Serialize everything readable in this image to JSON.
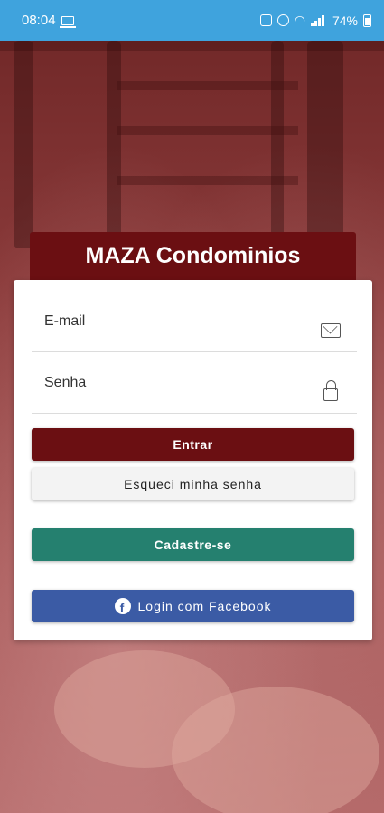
{
  "status_bar": {
    "time": "08:04",
    "battery": "74%",
    "icons": [
      "laptop-icon",
      "alarm-icon",
      "wifi-icon",
      "signal-icon",
      "battery-icon"
    ]
  },
  "app": {
    "title": "MAZA Condominios"
  },
  "login_form": {
    "email_placeholder": "E-mail",
    "email_icon": "mail-icon",
    "password_placeholder": "Senha",
    "password_icon": "lock-icon",
    "submit_label": "Entrar",
    "forgot_label": "Esqueci minha senha",
    "register_label": "Cadastre-se",
    "facebook_label": "Login com Facebook"
  },
  "colors": {
    "status_bar": "#3fa3dd",
    "brand": "#6b0f12",
    "register": "#25806f",
    "facebook": "#3b5ba5"
  }
}
